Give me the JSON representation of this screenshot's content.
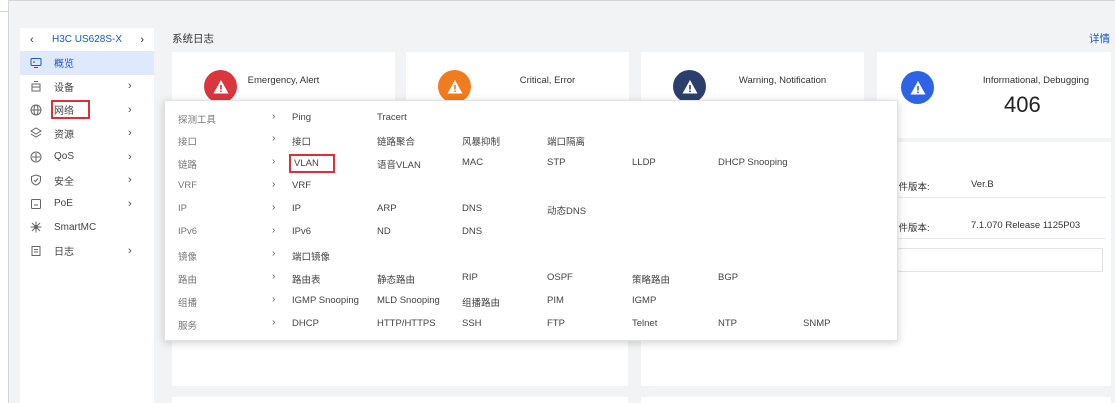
{
  "sidebar": {
    "device_name": "H3C US628S-X",
    "prev_arrow": "‹",
    "next_arrow": "›",
    "items": [
      {
        "label": "概览",
        "icon": "monitor-icon",
        "has_chevron": false
      },
      {
        "label": "设备",
        "icon": "device-icon",
        "has_chevron": true
      },
      {
        "label": "网络",
        "icon": "globe-icon",
        "has_chevron": true
      },
      {
        "label": "资源",
        "icon": "layers-icon",
        "has_chevron": true
      },
      {
        "label": "QoS",
        "icon": "qos-icon",
        "has_chevron": true
      },
      {
        "label": "安全",
        "icon": "shield-icon",
        "has_chevron": true
      },
      {
        "label": "PoE",
        "icon": "poe-icon",
        "has_chevron": true
      },
      {
        "label": "SmartMC",
        "icon": "cluster-icon",
        "has_chevron": false
      },
      {
        "label": "日志",
        "icon": "log-icon",
        "has_chevron": true
      }
    ],
    "chevron": "›"
  },
  "main": {
    "title": "系统日志",
    "detail_link": "详情"
  },
  "log_cards": [
    {
      "title": "Emergency, Alert",
      "color": "#d9363e",
      "count": ""
    },
    {
      "title": "Critical, Error",
      "color": "#f07c1e",
      "count": ""
    },
    {
      "title": "Warning, Notification",
      "color": "#2c3e6b",
      "count": ""
    },
    {
      "title": "Informational, Debugging",
      "color": "#2d63e6",
      "count": "406"
    }
  ],
  "device_info": [
    {
      "key": "硬件版本:",
      "value": "Ver.B"
    },
    {
      "key": "软件版本:",
      "value": "7.1.070 Release 1125P03"
    }
  ],
  "network_menu": {
    "arrow": "›",
    "rows": [
      {
        "category": "探测工具",
        "items": [
          "Ping",
          "Tracert"
        ]
      },
      {
        "category": "接口",
        "items": [
          "接口",
          "链路聚合",
          "风暴抑制",
          "端口隔离"
        ]
      },
      {
        "category": "链路",
        "items": [
          "VLAN",
          "语音VLAN",
          "MAC",
          "STP",
          "LLDP",
          "DHCP Snooping"
        ]
      },
      {
        "category": "VRF",
        "items": [
          "VRF"
        ]
      },
      {
        "category": "IP",
        "items": [
          "IP",
          "ARP",
          "DNS",
          "动态DNS"
        ]
      },
      {
        "category": "IPv6",
        "items": [
          "IPv6",
          "ND",
          "DNS"
        ]
      },
      {
        "category": "镜像",
        "items": [
          "端口镜像"
        ]
      },
      {
        "category": "路由",
        "items": [
          "路由表",
          "静态路由",
          "RIP",
          "OSPF",
          "策略路由",
          "BGP"
        ]
      },
      {
        "category": "组播",
        "items": [
          "IGMP Snooping",
          "MLD Snooping",
          "组播路由",
          "PIM",
          "IGMP"
        ]
      },
      {
        "category": "服务",
        "items": [
          "DHCP",
          "HTTP/HTTPS",
          "SSH",
          "FTP",
          "Telnet",
          "NTP",
          "SNMP"
        ]
      }
    ]
  },
  "colors": {
    "accent": "#1a56c6",
    "highlight_border": "#d9303b",
    "active_bg": "#dfe9fb"
  }
}
